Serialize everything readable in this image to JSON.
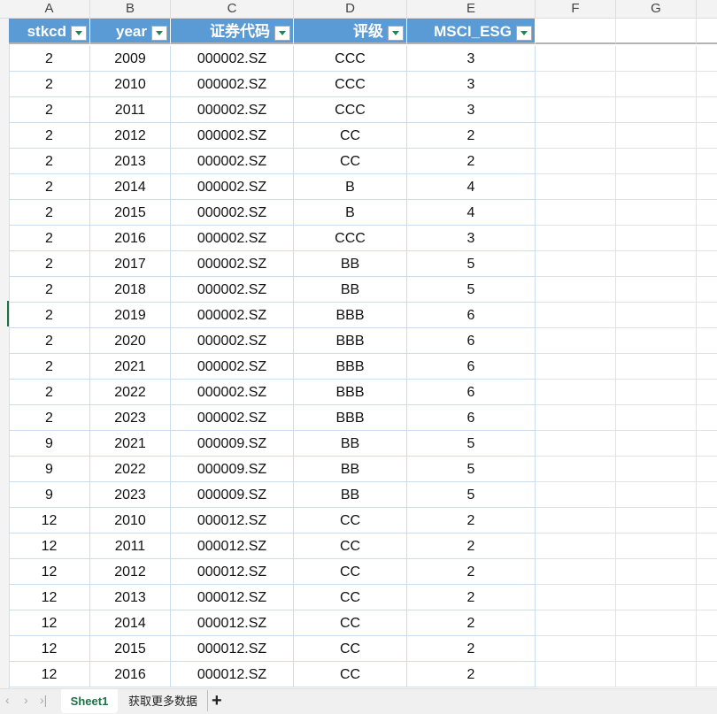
{
  "column_letters": [
    "A",
    "B",
    "C",
    "D",
    "E",
    "F",
    "G"
  ],
  "headers": [
    "stkcd",
    "year",
    "证券代码",
    "评级",
    "MSCI_ESG"
  ],
  "rows": [
    [
      "2",
      "2009",
      "000002.SZ",
      "CCC",
      "3"
    ],
    [
      "2",
      "2010",
      "000002.SZ",
      "CCC",
      "3"
    ],
    [
      "2",
      "2011",
      "000002.SZ",
      "CCC",
      "3"
    ],
    [
      "2",
      "2012",
      "000002.SZ",
      "CC",
      "2"
    ],
    [
      "2",
      "2013",
      "000002.SZ",
      "CC",
      "2"
    ],
    [
      "2",
      "2014",
      "000002.SZ",
      "B",
      "4"
    ],
    [
      "2",
      "2015",
      "000002.SZ",
      "B",
      "4"
    ],
    [
      "2",
      "2016",
      "000002.SZ",
      "CCC",
      "3"
    ],
    [
      "2",
      "2017",
      "000002.SZ",
      "BB",
      "5"
    ],
    [
      "2",
      "2018",
      "000002.SZ",
      "BB",
      "5"
    ],
    [
      "2",
      "2019",
      "000002.SZ",
      "BBB",
      "6"
    ],
    [
      "2",
      "2020",
      "000002.SZ",
      "BBB",
      "6"
    ],
    [
      "2",
      "2021",
      "000002.SZ",
      "BBB",
      "6"
    ],
    [
      "2",
      "2022",
      "000002.SZ",
      "BBB",
      "6"
    ],
    [
      "2",
      "2023",
      "000002.SZ",
      "BBB",
      "6"
    ],
    [
      "9",
      "2021",
      "000009.SZ",
      "BB",
      "5"
    ],
    [
      "9",
      "2022",
      "000009.SZ",
      "BB",
      "5"
    ],
    [
      "9",
      "2023",
      "000009.SZ",
      "BB",
      "5"
    ],
    [
      "12",
      "2010",
      "000012.SZ",
      "CC",
      "2"
    ],
    [
      "12",
      "2011",
      "000012.SZ",
      "CC",
      "2"
    ],
    [
      "12",
      "2012",
      "000012.SZ",
      "CC",
      "2"
    ],
    [
      "12",
      "2013",
      "000012.SZ",
      "CC",
      "2"
    ],
    [
      "12",
      "2014",
      "000012.SZ",
      "CC",
      "2"
    ],
    [
      "12",
      "2015",
      "000012.SZ",
      "CC",
      "2"
    ],
    [
      "12",
      "2016",
      "000012.SZ",
      "CC",
      "2"
    ]
  ],
  "sheet_tabs": {
    "active": "Sheet1",
    "other": "获取更多数据",
    "add": "+"
  },
  "nav": {
    "first": "‹",
    "next": "›",
    "last": "›|"
  }
}
